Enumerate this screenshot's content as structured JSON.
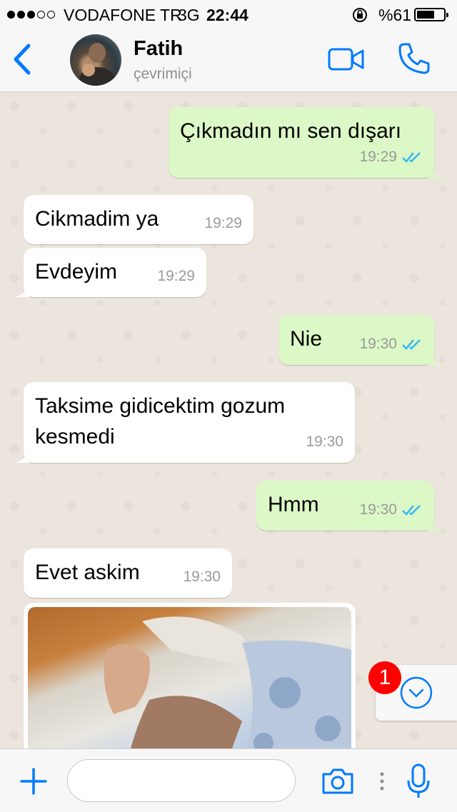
{
  "status_bar": {
    "carrier": "VODAFONE TR",
    "network": "3G",
    "time": "22:44",
    "battery_percent": "%61",
    "battery_level": 0.61
  },
  "header": {
    "contact_name": "Fatih",
    "contact_status": "çevrimiçi"
  },
  "messages": [
    {
      "direction": "out",
      "text": "Çıkmadın mı sen dışarı",
      "time": "19:29",
      "read": true
    },
    {
      "direction": "in",
      "text": "Cikmadim ya",
      "time": "19:29"
    },
    {
      "direction": "in",
      "text": "Evdeyim",
      "time": "19:29"
    },
    {
      "direction": "out",
      "text": "Nie",
      "time": "19:30",
      "read": true
    },
    {
      "direction": "in",
      "text": "Taksime gidicektim gozum kesmedi",
      "time": "19:30"
    },
    {
      "direction": "out",
      "text": "Hmm",
      "time": "19:30",
      "read": true
    },
    {
      "direction": "in",
      "text": "Evet askim",
      "time": "19:30"
    },
    {
      "direction": "in",
      "type": "photo"
    }
  ],
  "unread_count": "1",
  "colors": {
    "accent": "#007aff",
    "outgoing_bubble": "#dcf8c6",
    "incoming_bubble": "#ffffff",
    "read_ticks": "#34b7f1",
    "chat_background": "#ece5dd"
  }
}
